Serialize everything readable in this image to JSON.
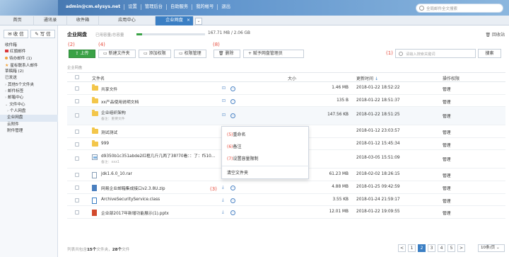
{
  "header": {
    "user": "admin@cm.elysys.net",
    "nav": [
      "设置",
      "管理后台",
      "自助服务",
      "我的帐号",
      "退出"
    ],
    "search_placeholder": "全局邮件全文搜索"
  },
  "tabs": [
    "首页",
    "通讯录",
    "收件箱",
    "应用中心",
    "企业网盘"
  ],
  "sidebar": {
    "receive": "收 信",
    "write": "写 信",
    "items": [
      "收件箱",
      "红旗邮件",
      "待办邮件 (1)",
      "星标联系人邮件",
      "草稿箱 (2)",
      "已发送",
      "其他5个文件夹",
      "邮件标签",
      "邮箱中心",
      "文件中心",
      "个人网盘",
      "企业网盘",
      "云附件",
      "附件管理"
    ]
  },
  "main": {
    "title": "企业网盘",
    "cap_label": "已用容量/总容量",
    "cap_value": "167.71 MB / 2.06 GB",
    "cap_fraction": 0.08,
    "recycle": "回收站",
    "breadcrumb": "企业网盘"
  },
  "toolbar": {
    "upload": "上传",
    "new_folder": "新建文件夹",
    "add_perm": "添加权限",
    "perm_mgr": "权限管理",
    "delete": "删除",
    "assign": "+ 赋予网盘管理员",
    "search_placeholder": "请输入搜索关键词",
    "search_btn": "搜索"
  },
  "annotations": {
    "a1": "(1)",
    "a2": "(2)",
    "a3": "(3)",
    "a4": "(4)",
    "a5": "(5)",
    "a6": "(6)",
    "a7": "(7)",
    "a8": "(8)"
  },
  "table": {
    "headers": {
      "name": "文件名",
      "size": "大小",
      "updated": "更新时间",
      "perm": "操作权限"
    },
    "rows": [
      {
        "name": "共享文件",
        "sub": "",
        "size": "1.46 MB",
        "time": "2018-01-22 18:52:22",
        "perm": "管理",
        "type": "folder"
      },
      {
        "name": "xx产品使用说明文档",
        "sub": "",
        "size": "135 B",
        "time": "2018-01-22 18:51:37",
        "perm": "管理",
        "type": "folder"
      },
      {
        "name": "企业组织架构",
        "sub": "备注：重要文件",
        "size": "147.56 KB",
        "time": "2018-01-22 18:51:25",
        "perm": "管理",
        "type": "folder"
      },
      {
        "name": "测试测试",
        "sub": "",
        "size": "",
        "time": "2018-01-12 23:03:57",
        "perm": "管理",
        "type": "folder"
      },
      {
        "name": "999",
        "sub": "",
        "size": "",
        "time": "2018-01-12 15:45:34",
        "perm": "管理",
        "type": "folder"
      },
      {
        "name": "d9350b1c351abde2红框几斤几两了38?70看：：了：f510...",
        "sub": "备注：xxx1",
        "size": "",
        "time": "2018-03-05 15:51:09",
        "perm": "管理",
        "type": "img"
      },
      {
        "name": "jdk1.6.0_10.rar",
        "sub": "",
        "size": "61.23 MB",
        "time": "2018-02-02 18:26:15",
        "perm": "管理",
        "type": "doc"
      },
      {
        "name": "网易企业邮箱集成接口v2.3.8U.zip",
        "sub": "",
        "size": "4.88 MB",
        "time": "2018-01-25 09:42:59",
        "perm": "管理",
        "type": "zip"
      },
      {
        "name": "ArchiveSecurityService.class",
        "sub": "",
        "size": "3.55 KB",
        "time": "2018-01-24 21:59:17",
        "perm": "管理",
        "type": "cls"
      },
      {
        "name": "企业部2017年新增功能展示(1).pptx",
        "sub": "",
        "size": "12.01 MB",
        "time": "2018-01-22 19:09:55",
        "perm": "管理",
        "type": "ppt"
      }
    ]
  },
  "context_menu": {
    "rename": "重命名",
    "note": "备注",
    "limit": "设置容量限制",
    "clear": "清空文件夹"
  },
  "footer": {
    "text_pre": "列表共包含",
    "folders": "15个",
    "text_mid": "文件夹，",
    "files": "28个",
    "text_post": "文件"
  },
  "pager": {
    "pages": [
      "<",
      "1",
      "2",
      "3",
      "4",
      "5",
      ">"
    ],
    "current": "2",
    "per_page": "10条/页"
  }
}
